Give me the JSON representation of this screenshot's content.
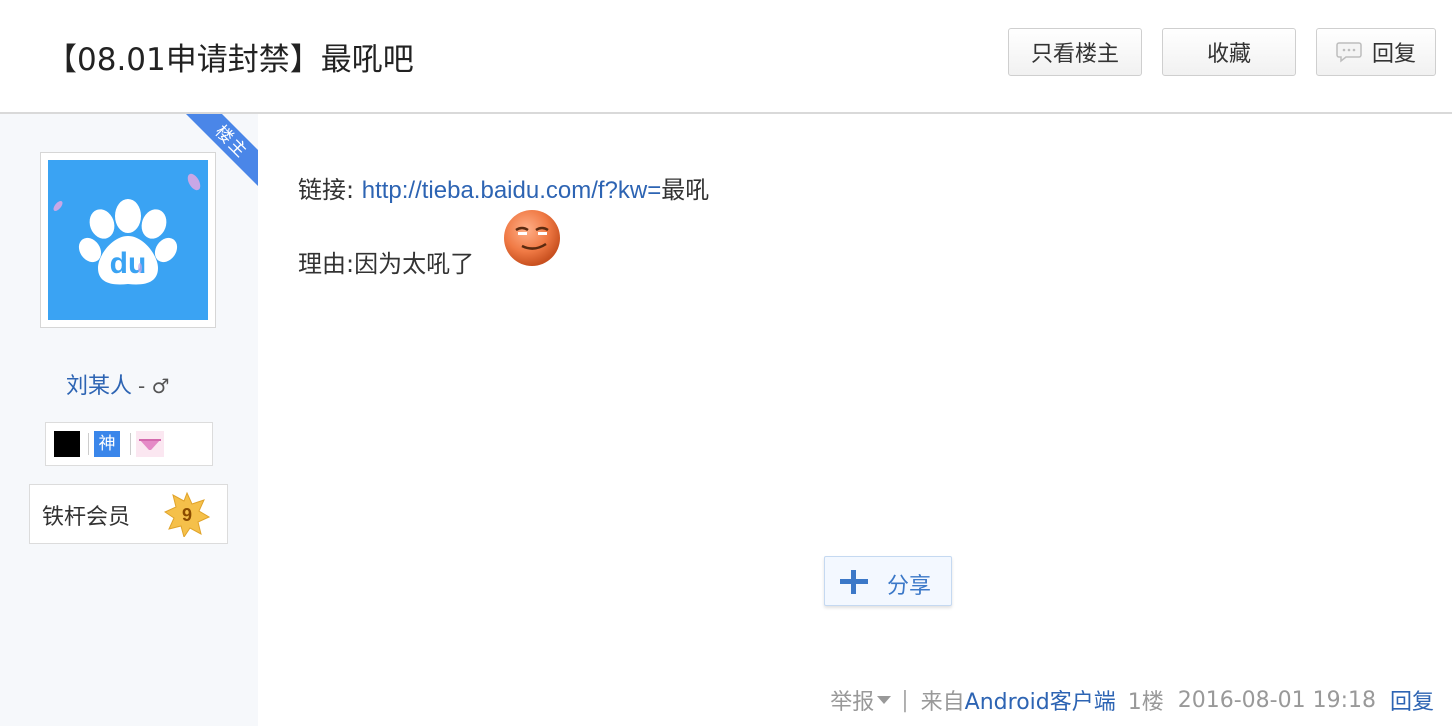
{
  "header": {
    "title": "【08.01申请封禁】最吼吧",
    "buttons": {
      "only_owner": "只看楼主",
      "favorite": "收藏",
      "reply": "回复"
    }
  },
  "sidebar": {
    "owner_ribbon": "楼主",
    "username": "刘某人",
    "gender_symbol": "- ♂",
    "badges": [
      {
        "icon": "black-square-badge-icon",
        "color": "#000000"
      },
      {
        "icon": "shen-badge-icon",
        "text": "神",
        "color": "#3a86ea"
      },
      {
        "icon": "pink-underwear-badge-icon",
        "color": "#e58ac7"
      }
    ],
    "member_label": "铁杆会员",
    "member_level": "9"
  },
  "post": {
    "link_prefix": "链接: ",
    "link_url": "http://tieba.baidu.com/f?kw=",
    "link_suffix": "最吼",
    "reason": "理由:因为太吼了",
    "share_label": "分享"
  },
  "footer": {
    "report": "举报",
    "pipe": "|",
    "from_prefix": "来自",
    "client": "Android客户端",
    "floor": "1楼",
    "timestamp": "2016-08-01 19:18",
    "reply": "回复"
  },
  "colors": {
    "link": "#2d64b3",
    "sidebar_bg": "#f6f8fb",
    "ribbon": "#4a86e8",
    "avatar_bg": "#3aa3f3"
  }
}
